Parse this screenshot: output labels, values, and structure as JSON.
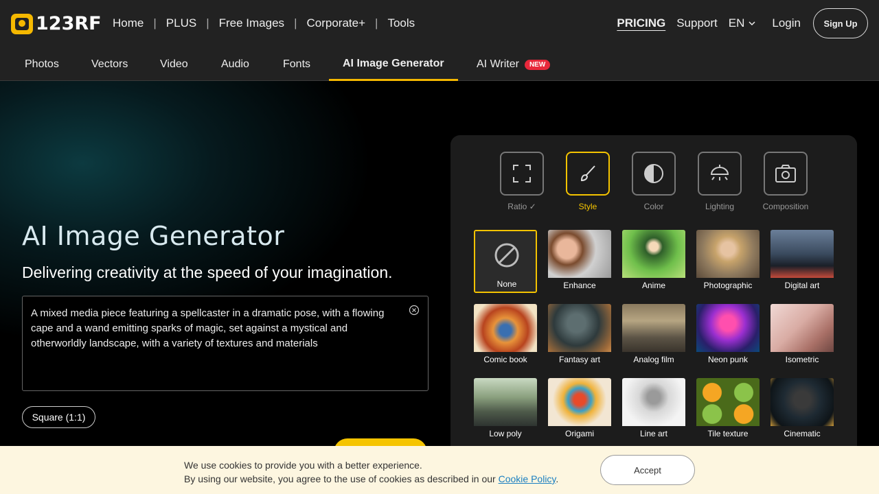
{
  "header": {
    "logo_text": "123RF",
    "nav": [
      "Home",
      "PLUS",
      "Free Images",
      "Corporate+",
      "Tools"
    ],
    "separator": "|",
    "pricing": "PRICING",
    "support": "Support",
    "language": "EN",
    "login": "Login",
    "signup": "Sign Up"
  },
  "categories": {
    "photos": "Photos",
    "vectors": "Vectors",
    "video": "Video",
    "audio": "Audio",
    "fonts": "Fonts",
    "ai_image": "AI Image Generator",
    "ai_writer": "AI Writer",
    "new_badge": "NEW"
  },
  "hero": {
    "title": "AI Image Generator",
    "subtitle": "Delivering creativity at the speed of your imagination.",
    "prompt": "A mixed media piece featuring a spellcaster in a dramatic pose, with a flowing cape and a wand emitting sparks of magic, set against a mystical and otherworldly landscape, with a variety of textures and materials",
    "ratio_button": "Square (1:1)"
  },
  "options": {
    "ratio": "Ratio",
    "style": "Style",
    "color": "Color",
    "lighting": "Lighting",
    "composition": "Composition"
  },
  "styles": {
    "none": "None",
    "enhance": "Enhance",
    "anime": "Anime",
    "photographic": "Photographic",
    "digital_art": "Digital art",
    "comic_book": "Comic book",
    "fantasy_art": "Fantasy art",
    "analog_film": "Analog film",
    "neon_punk": "Neon punk",
    "isometric": "Isometric",
    "low_poly": "Low poly",
    "origami": "Origami",
    "line_art": "Line art",
    "tile_texture": "Tile texture",
    "cinematic": "Cinematic"
  },
  "cookie": {
    "line1": "We use cookies to provide you with a better experience.",
    "line2_prefix": "By using our website, you agree to the use of cookies as described in our ",
    "link": "Cookie Policy",
    "line2_suffix": ".",
    "accept": "Accept"
  },
  "colors": {
    "accent": "#f5c400",
    "badge": "#e8283b",
    "link": "#1a7fc1"
  }
}
